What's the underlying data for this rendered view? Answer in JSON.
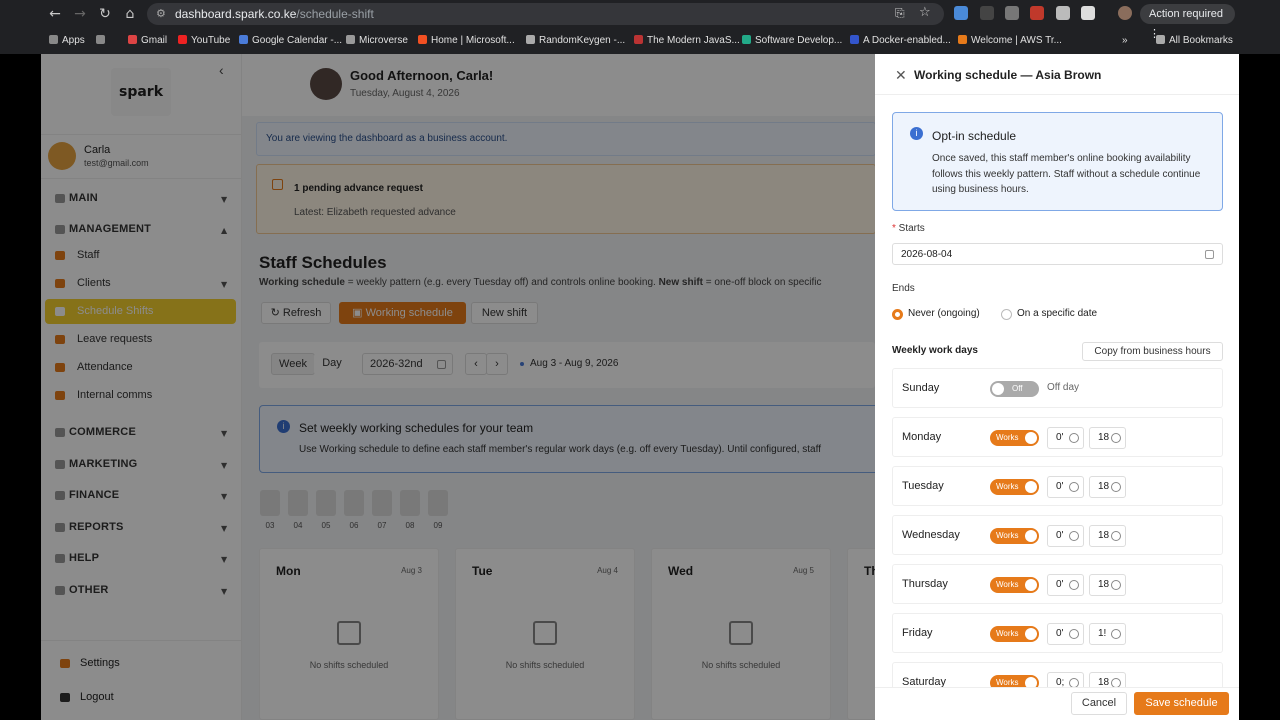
{
  "browser": {
    "url_host": "dashboard.spark.co.ke",
    "url_path": "/schedule-shift",
    "action_label": "Action required",
    "bookmarks": [
      "Apps",
      "Gmail",
      "YouTube",
      "Google Calendar -...",
      "Microverse",
      "Home | Microsoft...",
      "RandomKeygen -...",
      "The Modern JavaS...",
      "Software Develop...",
      "A Docker-enabled...",
      "Welcome | AWS Tr...",
      "All Bookmarks"
    ]
  },
  "sidebar": {
    "logo": "spark",
    "user_name": "Carla",
    "user_email": "test@gmail.com",
    "sections": {
      "main": "MAIN",
      "management": "MANAGEMENT",
      "commerce": "COMMERCE",
      "marketing": "MARKETING",
      "finance": "FINANCE",
      "reports": "REPORTS",
      "help": "HELP",
      "other": "OTHER"
    },
    "items": {
      "staff": "Staff",
      "clients": "Clients",
      "schedule": "Schedule Shifts",
      "leave": "Leave requests",
      "attendance": "Attendance",
      "comms": "Internal comms"
    },
    "settings": "Settings",
    "logout": "Logout"
  },
  "main": {
    "greeting": "Good Afternoon, Carla!",
    "date": "Tuesday, August 4, 2026",
    "business_notice": "You are viewing the dashboard as a business account.",
    "pending_title": "1 pending advance request",
    "pending_detail": "Latest: Elizabeth requested advance",
    "page_title": "Staff Schedules",
    "subtitle_a": "Working schedule",
    "subtitle_b": " = weekly pattern (e.g. every Tuesday off) and controls online booking. ",
    "subtitle_c": "New shift",
    "subtitle_d": " = one-off block on specific",
    "refresh": "Refresh",
    "working_schedule": "Working schedule",
    "new_shift": "New shift",
    "week": "Week",
    "day": "Day",
    "week_value": "2026-32nd",
    "range": "Aug 3 - Aug 9, 2026",
    "info_title": "Set weekly working schedules for your team",
    "info_text": "Use Working schedule to define each staff member's regular work days (e.g. off every Tuesday). Until configured, staff",
    "date_strip": [
      "03",
      "04",
      "05",
      "06",
      "07",
      "08",
      "09"
    ],
    "cards": [
      {
        "day": "Mon",
        "date": "Aug 3",
        "empty": "No shifts scheduled"
      },
      {
        "day": "Tue",
        "date": "Aug 4",
        "empty": "No shifts scheduled"
      },
      {
        "day": "Wed",
        "date": "Aug 5",
        "empty": "No shifts scheduled"
      },
      {
        "day": "Th"
      }
    ]
  },
  "drawer": {
    "title": "Working schedule — Asia Brown",
    "optin_title": "Opt-in schedule",
    "optin_text": "Once saved, this staff member's online booking availability follows this weekly pattern. Staff without a schedule continue using business hours.",
    "starts_label": "Starts",
    "starts_value": "2026-08-04",
    "ends_label": "Ends",
    "ends_never": "Never (ongoing)",
    "ends_date": "On a specific date",
    "weekly_label": "Weekly work days",
    "copy_btn": "Copy from business hours",
    "works": "Works",
    "off": "Off",
    "off_day": "Off day",
    "days": [
      {
        "name": "Sunday",
        "works": false
      },
      {
        "name": "Monday",
        "works": true,
        "start": "0'",
        "end": "18"
      },
      {
        "name": "Tuesday",
        "works": true,
        "start": "0'",
        "end": "18"
      },
      {
        "name": "Wednesday",
        "works": true,
        "start": "0'",
        "end": "18"
      },
      {
        "name": "Thursday",
        "works": true,
        "start": "0'",
        "end": "18"
      },
      {
        "name": "Friday",
        "works": true,
        "start": "0'",
        "end": "1!"
      },
      {
        "name": "Saturday",
        "works": true,
        "start": "0;",
        "end": "18"
      }
    ],
    "cancel": "Cancel",
    "save": "Save schedule"
  },
  "colors": {
    "accent": "#e67a1a",
    "info_bg": "#eef4fd",
    "info_border": "#7fa8e6"
  }
}
